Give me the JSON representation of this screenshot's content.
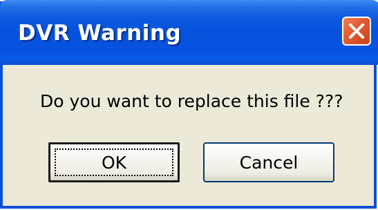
{
  "dialog": {
    "title": "DVR Warning",
    "message": "Do you want to replace this file ???",
    "buttons": {
      "ok_label": "OK",
      "cancel_label": "Cancel"
    },
    "close_icon": "close-icon"
  },
  "colors": {
    "titlebar": "#0651dc",
    "body": "#ece9d8",
    "close_button": "#e25a32",
    "button_border": "#003c74"
  }
}
